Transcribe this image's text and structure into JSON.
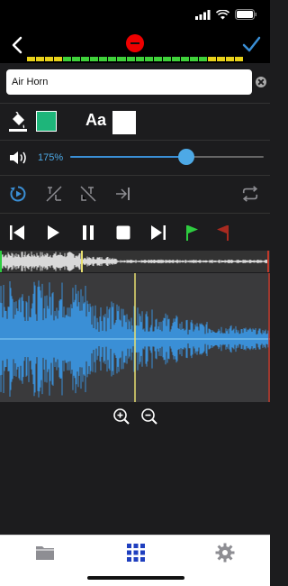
{
  "status_bar": {
    "icons": [
      "signal-icon",
      "wifi-icon",
      "battery-icon"
    ]
  },
  "nav": {
    "back_icon": "chevron-left-icon",
    "record_icon": "record-icon",
    "done_icon": "checkmark-icon"
  },
  "level_meter": {
    "colors": [
      "#e8d21a",
      "#e8d21a",
      "#e8d21a",
      "#e8d21a",
      "#3fd23a",
      "#3fd23a",
      "#3fd23a",
      "#3fd23a",
      "#3fd23a",
      "#3fd23a",
      "#3fd23a",
      "#3fd23a",
      "#3fd23a",
      "#3fd23a",
      "#3fd23a",
      "#3fd23a",
      "#3fd23a",
      "#3fd23a",
      "#3fd23a",
      "#3fd23a",
      "#e8d21a",
      "#e8d21a",
      "#e8d21a",
      "#e8d21a"
    ]
  },
  "sound": {
    "name": "Air Horn"
  },
  "style": {
    "fill_color": "#1eb57a",
    "font_label": "Aa",
    "text_color": "#ffffff"
  },
  "volume": {
    "label": "175%",
    "level": 0.6
  },
  "tools": [
    "replay-icon",
    "fade-in-icon",
    "fade-out-icon",
    "trim-end-icon",
    "loop-icon"
  ],
  "transport": [
    "skip-back-icon",
    "play-icon",
    "pause-icon",
    "stop-icon",
    "skip-forward-icon",
    "start-marker-flag-icon",
    "end-marker-flag-icon"
  ],
  "colors": {
    "accent": "#4da9e6",
    "waveform": "#3a8fd6",
    "start_marker": "#2ecc40",
    "end_marker": "#c0392b",
    "playhead": "#e8e070"
  },
  "zoom": [
    "zoom-in-icon",
    "zoom-out-icon"
  ],
  "tabs": [
    {
      "name": "folder-icon",
      "active": false
    },
    {
      "name": "grid-icon",
      "active": true
    },
    {
      "name": "gear-icon",
      "active": false
    }
  ]
}
